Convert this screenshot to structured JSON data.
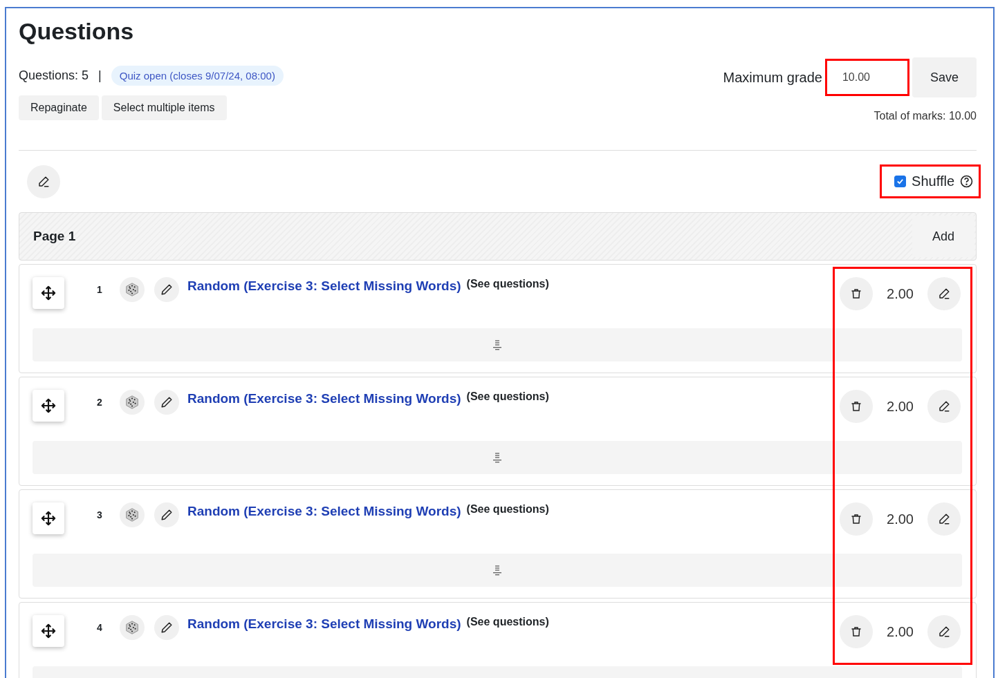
{
  "title": "Questions",
  "summary": {
    "count": "Questions: 5",
    "separator": "|",
    "status": "Quiz open (closes 9/07/24, 08:00)"
  },
  "actions": [
    "Repaginate",
    "Select multiple items"
  ],
  "grade": {
    "label": "Maximum grade",
    "value": "10.00",
    "highlighted": true,
    "save": "Save",
    "total": "Total of marks: 10.00"
  },
  "shuffle": {
    "label": "Shuffle",
    "checked": true,
    "highlighted": true
  },
  "page": {
    "title": "Page 1",
    "add": "Add",
    "marks_highlighted": true
  },
  "questions": [
    {
      "number": "1",
      "title": "Random (Exercise 3: Select Missing Words)",
      "note": "(See questions)",
      "mark": "2.00"
    },
    {
      "number": "2",
      "title": "Random (Exercise 3: Select Missing Words)",
      "note": "(See questions)",
      "mark": "2.00"
    },
    {
      "number": "3",
      "title": "Random (Exercise 3: Select Missing Words)",
      "note": "(See questions)",
      "mark": "2.00"
    },
    {
      "number": "4",
      "title": "Random (Exercise 3: Select Missing Words)",
      "note": "(See questions)",
      "mark": "2.00"
    }
  ]
}
